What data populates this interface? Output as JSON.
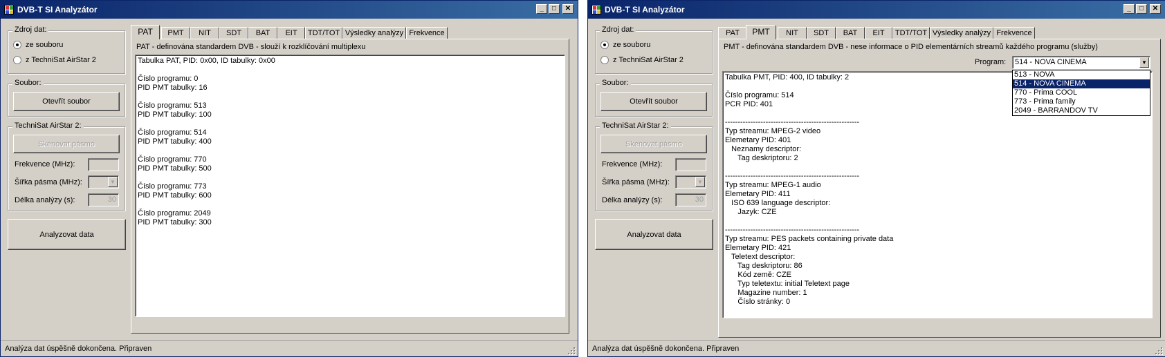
{
  "window_title": "DVB-T SI Analyzátor",
  "window_controls": {
    "minimize": "_",
    "maximize": "□",
    "close": "✕"
  },
  "source_group": {
    "title": "Zdroj dat:",
    "option_file": "ze souboru",
    "option_device": "z TechniSat AirStar 2"
  },
  "file_group": {
    "title": "Soubor:",
    "open_button": "Otevřít soubor"
  },
  "device_group": {
    "title": "TechniSat AirStar 2:",
    "scan_button": "Skenovat pásmo",
    "frequency_label": "Frekvence (MHz):",
    "bandwidth_label": "Šířka pásma (MHz):",
    "duration_label": "Délka analýzy (s):",
    "duration_value": "30"
  },
  "analyze_button": "Analyzovat data",
  "tabs": [
    "PAT",
    "PMT",
    "NIT",
    "SDT",
    "BAT",
    "EIT",
    "TDT/TOT",
    "Výsledky analýzy",
    "Frekvence"
  ],
  "status_text": "Analýza dat úspěšně dokončena. Připraven",
  "left": {
    "active_tab": "PAT",
    "description": "PAT - definována standardem DVB - slouží k rozklíčování multiplexu",
    "content": "Tabulka PAT, PID: 0x00, ID tabulky: 0x00\n\nČíslo programu: 0\nPID PMT tabulky: 16\n\nČíslo programu: 513\nPID PMT tabulky: 100\n\nČíslo programu: 514\nPID PMT tabulky: 400\n\nČíslo programu: 770\nPID PMT tabulky: 500\n\nČíslo programu: 773\nPID PMT tabulky: 600\n\nČíslo programu: 2049\nPID PMT tabulky: 300"
  },
  "right": {
    "active_tab": "PMT",
    "description": "PMT - definována standardem DVB - nese informace o  PID elementárních streamů každého programu (služby)",
    "program_label": "Program:",
    "program_selected": "514 - NOVA CINEMA",
    "program_options": [
      "513 - NOVA",
      "514 - NOVA CINEMA",
      "770 - Prima COOL",
      "773 - Prima family",
      "2049 - BARRANDOV TV"
    ],
    "content": "Tabulka PMT, PID: 400, ID tabulky: 2\n\nČíslo programu: 514\nPCR PID: 401\n\n-----------------------------------------------------\nTyp streamu: MPEG-2 video\nElemetary PID: 401\n   Neznamy descriptor:\n      Tag deskriptoru: 2\n\n-----------------------------------------------------\nTyp streamu: MPEG-1 audio\nElemetary PID: 411\n   ISO 639 language descriptor:\n      Jazyk: CZE\n\n-----------------------------------------------------\nTyp streamu: PES packets containing private data\nElemetary PID: 421\n   Teletext descriptor:\n      Tag deskriptoru: 86\n      Kód země: CZE\n      Typ teletextu: initial Teletext page\n      Magazine number: 1\n      Číslo stránky: 0"
  }
}
